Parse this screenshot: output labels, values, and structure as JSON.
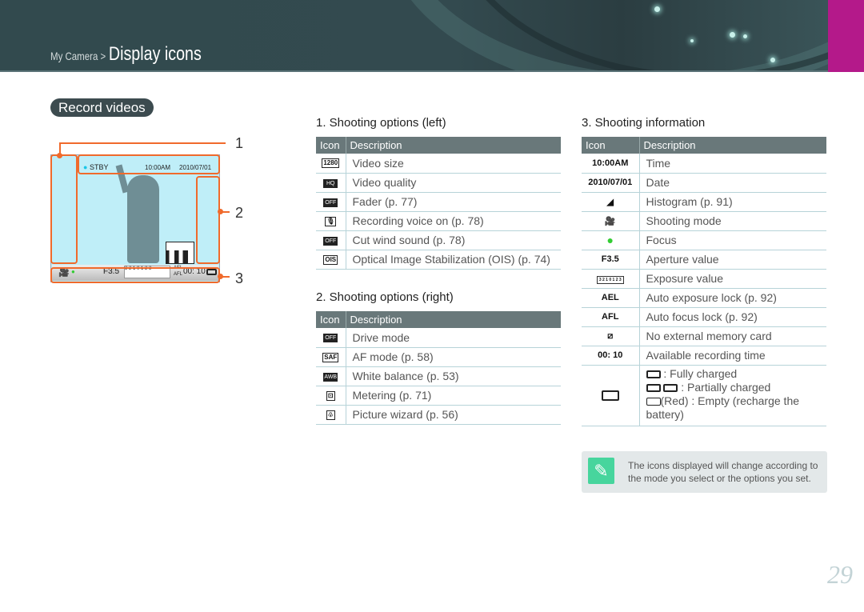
{
  "header": {
    "breadcrumb_parent": "My Camera >",
    "breadcrumb_current": "Display icons"
  },
  "section_title": "Record videos",
  "camera_screen": {
    "status": "STBY",
    "time": "10:00AM",
    "date": "2010/07/01",
    "aperture": "F3.5",
    "ev_scale": "3 2 1 0 1 2 3",
    "ael": "AEL",
    "afl": "AFL",
    "rec_time": "00: 10",
    "callouts": [
      "1",
      "2",
      "3"
    ]
  },
  "tables": [
    {
      "title": "1. Shooting options (left)",
      "headers": [
        "Icon",
        "Description"
      ],
      "rows": [
        {
          "icon": "video-size-icon",
          "icon_text": "1280",
          "desc": "Video size"
        },
        {
          "icon": "video-quality-icon",
          "icon_text": "HQ",
          "desc": "Video quality"
        },
        {
          "icon": "fader-icon",
          "icon_text": "OFF",
          "desc": "Fader (p. 77)"
        },
        {
          "icon": "microphone-icon",
          "icon_text": "🎙",
          "desc": "Recording voice on (p. 78)"
        },
        {
          "icon": "wind-cut-icon",
          "icon_text": "OFF",
          "desc": "Cut wind sound (p. 78)"
        },
        {
          "icon": "ois-icon",
          "icon_text": "OIS",
          "desc": "Optical Image Stabilization (OIS) (p. 74)"
        }
      ]
    },
    {
      "title": "2. Shooting options (right)",
      "headers": [
        "Icon",
        "Description"
      ],
      "rows": [
        {
          "icon": "drive-mode-icon",
          "icon_text": "OFF",
          "desc": "Drive mode"
        },
        {
          "icon": "af-mode-icon",
          "icon_text": "SAF",
          "desc": "AF mode (p. 58)"
        },
        {
          "icon": "white-balance-icon",
          "icon_text": "AWB",
          "desc": "White balance (p. 53)"
        },
        {
          "icon": "metering-icon",
          "icon_text": "⊡",
          "desc": "Metering (p. 71)"
        },
        {
          "icon": "picture-wizard-icon",
          "icon_text": "♧",
          "desc": "Picture wizard (p. 56)"
        }
      ]
    },
    {
      "title": "3. Shooting information",
      "headers": [
        "Icon",
        "Description"
      ],
      "rows": [
        {
          "icon": "time-icon",
          "icon_text": "10:00AM",
          "desc": "Time"
        },
        {
          "icon": "date-icon",
          "icon_text": "2010/07/01",
          "desc": "Date"
        },
        {
          "icon": "histogram-icon",
          "icon_text": "◢",
          "desc": "Histogram (p. 91)"
        },
        {
          "icon": "shooting-mode-icon",
          "icon_text": "🎥",
          "desc": "Shooting mode"
        },
        {
          "icon": "focus-icon",
          "icon_text": "●",
          "desc": "Focus"
        },
        {
          "icon": "aperture-icon",
          "icon_text": "F3.5",
          "desc": "Aperture value"
        },
        {
          "icon": "exposure-scale-icon",
          "icon_text": "3 2 1 0 1 2 3",
          "desc": "Exposure value"
        },
        {
          "icon": "ael-icon",
          "icon_text": "AEL",
          "desc": "Auto exposure lock (p. 92)"
        },
        {
          "icon": "afl-icon",
          "icon_text": "AFL",
          "desc": "Auto focus lock (p. 92)"
        },
        {
          "icon": "no-memory-card-icon",
          "icon_text": "⧄",
          "desc": "No external memory card"
        },
        {
          "icon": "recording-time-icon",
          "icon_text": "00: 10",
          "desc": "Available recording time"
        }
      ]
    }
  ],
  "battery": {
    "full": ": Fully charged",
    "partial": ": Partially charged",
    "empty": "(Red) : Empty (recharge the battery)"
  },
  "note": "The icons displayed will change according to the mode you select or the options you set.",
  "page_number": "29",
  "colors": {
    "accent_orange": "#f06a2c",
    "brand_pink": "#b4198a",
    "focus_green": "#33cc33",
    "header_gray": "#69787a"
  }
}
